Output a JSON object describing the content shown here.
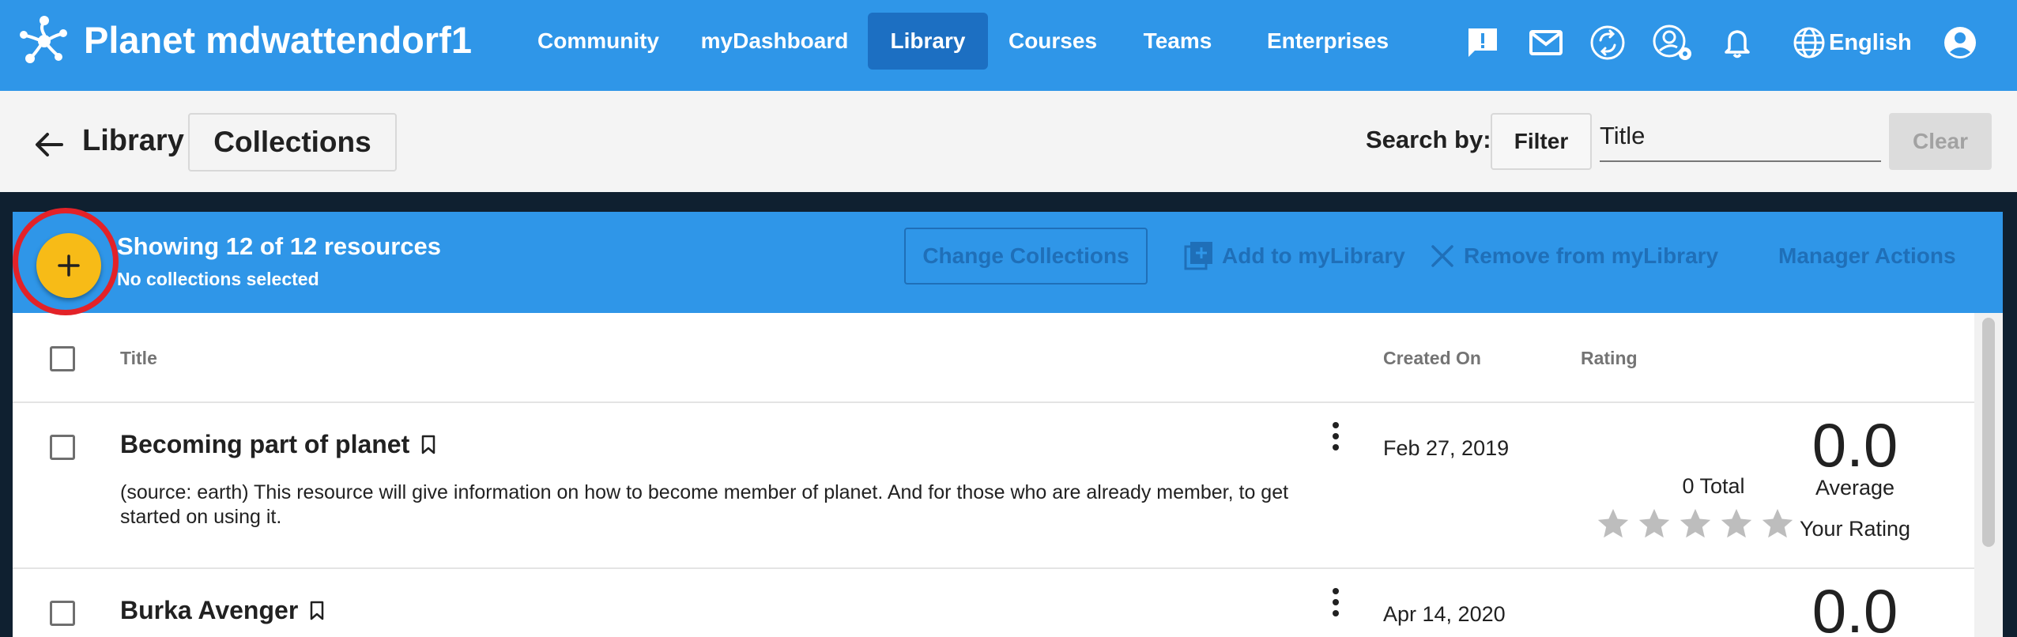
{
  "topbar": {
    "brand": "Planet mdwattendorf1",
    "nav": [
      {
        "label": "Community",
        "active": false
      },
      {
        "label": "myDashboard",
        "active": false
      },
      {
        "label": "Library",
        "active": true
      },
      {
        "label": "Courses",
        "active": false
      },
      {
        "label": "Teams",
        "active": false
      },
      {
        "label": "Enterprises",
        "active": false
      }
    ],
    "icons": [
      "feedback-icon",
      "mail-icon",
      "sync-icon",
      "user-settings-icon",
      "bell-icon"
    ],
    "language": "English",
    "account_icon": "account-circle-icon"
  },
  "subbar": {
    "back_icon": "arrow-back-icon",
    "breadcrumb": "Library",
    "collections_button": "Collections",
    "search_label": "Search by:",
    "filter_button": "Filter",
    "search_value": "Title",
    "clear_button": "Clear"
  },
  "actionbar": {
    "add_icon": "plus-icon",
    "showing": "Showing 12 of 12 resources",
    "selected_note": "No collections selected",
    "change_collections": "Change Collections",
    "add_to_library": "Add to myLibrary",
    "remove_from_library": "Remove from myLibrary",
    "manager_actions": "Manager Actions"
  },
  "table": {
    "headers": {
      "title": "Title",
      "created_on": "Created On",
      "rating": "Rating"
    },
    "rows": [
      {
        "title": "Becoming part of planet",
        "description": "(source: earth) This resource will give information on how to become member of planet. And for those who are already member, to get started on using it.",
        "created_on": "Feb 27, 2019",
        "rating": "0.0",
        "total": "0 Total",
        "average_label": "Average",
        "your_rating_label": "Your Rating",
        "stars": 5
      },
      {
        "title": "Burka Avenger",
        "description": "",
        "created_on": "Apr 14, 2020",
        "rating": "0.0"
      }
    ]
  },
  "colors": {
    "primary": "#2f96e8",
    "primary_dark": "#1c6fc2",
    "accent": "#f7bb17",
    "highlight_ring": "#e32228",
    "disabled_text": "#1f6fb8"
  }
}
